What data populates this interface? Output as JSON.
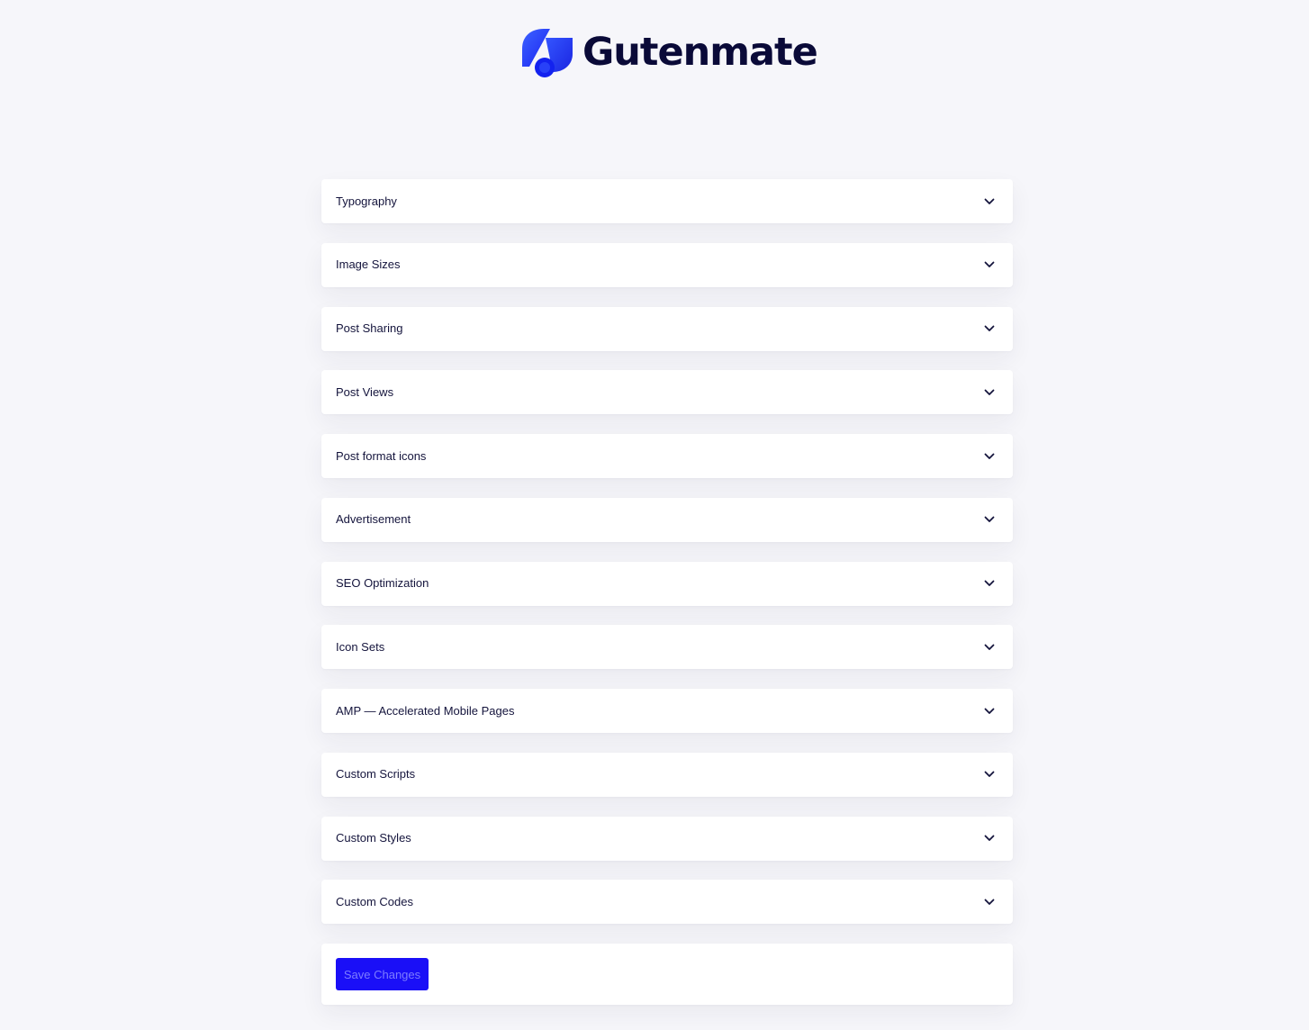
{
  "brand": {
    "name": "Gutenmate",
    "accent_color": "#1a0ff7",
    "logo_gradient": [
      "#3b5bff",
      "#1a0ff7"
    ]
  },
  "settings": {
    "sections": [
      {
        "label": "Typography",
        "icon": "chevron-down-icon"
      },
      {
        "label": "Image Sizes",
        "icon": "chevron-down-icon"
      },
      {
        "label": "Post Sharing",
        "icon": "chevron-down-icon"
      },
      {
        "label": "Post Views",
        "icon": "chevron-down-icon"
      },
      {
        "label": "Post format icons",
        "icon": "chevron-down-icon"
      },
      {
        "label": "Advertisement",
        "icon": "chevron-down-icon"
      },
      {
        "label": "SEO Optimization",
        "icon": "chevron-down-icon"
      },
      {
        "label": "Icon Sets",
        "icon": "chevron-down-icon"
      },
      {
        "label": "AMP — Accelerated Mobile Pages",
        "icon": "chevron-down-icon"
      },
      {
        "label": "Custom Scripts",
        "icon": "chevron-down-icon"
      },
      {
        "label": "Custom Styles",
        "icon": "chevron-down-icon"
      },
      {
        "label": "Custom Codes",
        "icon": "chevron-down-icon"
      }
    ]
  },
  "actions": {
    "save_label": "Save Changes"
  }
}
